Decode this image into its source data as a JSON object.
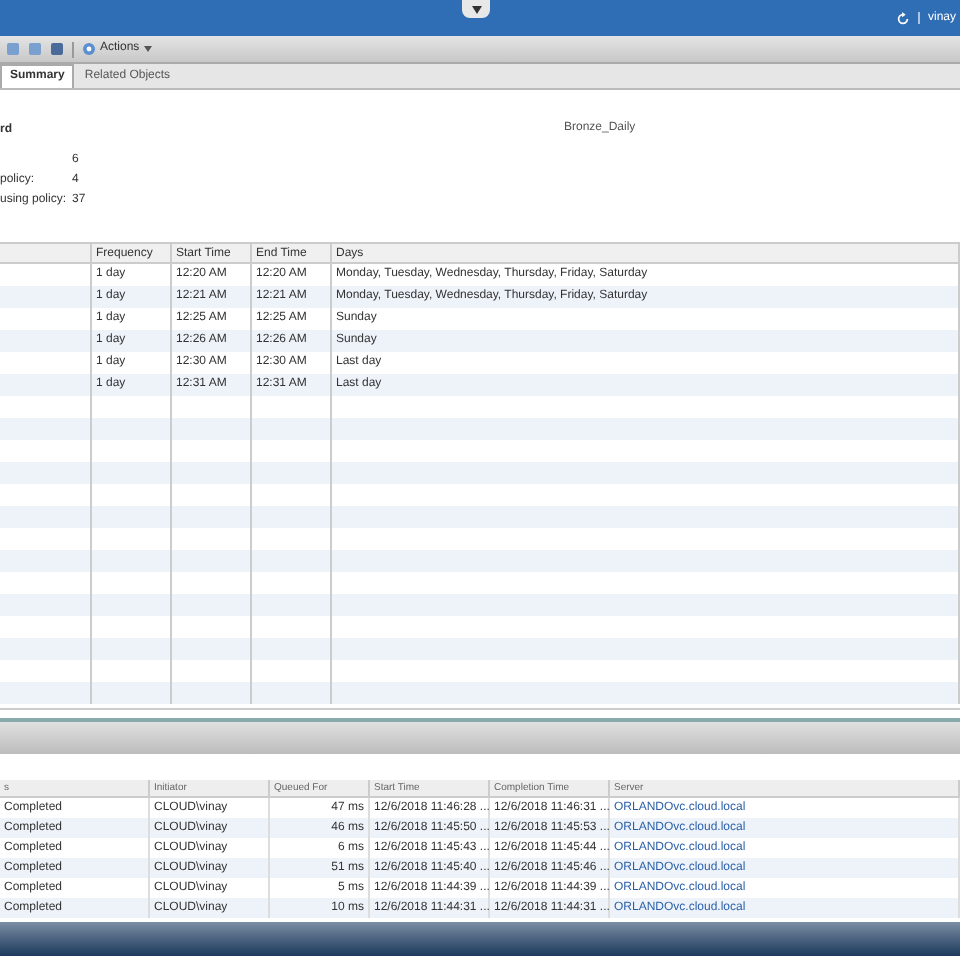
{
  "top_bar": {
    "user": "vinay"
  },
  "toolbar": {
    "actions": "Actions"
  },
  "tabs": [
    {
      "label": "Summary",
      "selected": true
    },
    {
      "label": "Related Objects",
      "selected": false
    }
  ],
  "summary": {
    "heading": "rd",
    "name": "Bronze_Daily",
    "stats": [
      {
        "value": "6"
      },
      {
        "label": "policy:",
        "value": "4"
      },
      {
        "label": "using policy:",
        "value": "37"
      }
    ]
  },
  "schedule_table": {
    "columns": [
      "Frequency",
      "Start Time",
      "End Time",
      "Days"
    ],
    "rows": [
      [
        "1 day",
        "12:20 AM",
        "12:20 AM",
        "Monday, Tuesday, Wednesday, Thursday, Friday, Saturday"
      ],
      [
        "1 day",
        "12:21 AM",
        "12:21 AM",
        "Monday, Tuesday, Wednesday, Thursday, Friday, Saturday"
      ],
      [
        "1 day",
        "12:25 AM",
        "12:25 AM",
        "Sunday"
      ],
      [
        "1 day",
        "12:26 AM",
        "12:26 AM",
        "Sunday"
      ],
      [
        "1 day",
        "12:30 AM",
        "12:30 AM",
        "Last day"
      ],
      [
        "1 day",
        "12:31 AM",
        "12:31 AM",
        "Last day"
      ]
    ]
  },
  "tasks_table": {
    "columns": [
      "s",
      "Initiator",
      "Queued For",
      "Start Time",
      "Completion Time",
      "Server"
    ],
    "rows": [
      [
        "Completed",
        "CLOUD\\vinay",
        "47 ms",
        "12/6/2018 11:46:28 ...",
        "12/6/2018 11:46:31 ...",
        "ORLANDOvc.cloud.local"
      ],
      [
        "Completed",
        "CLOUD\\vinay",
        "46 ms",
        "12/6/2018 11:45:50 ...",
        "12/6/2018 11:45:53 ...",
        "ORLANDOvc.cloud.local"
      ],
      [
        "Completed",
        "CLOUD\\vinay",
        "6 ms",
        "12/6/2018 11:45:43 ...",
        "12/6/2018 11:45:44 ...",
        "ORLANDOvc.cloud.local"
      ],
      [
        "Completed",
        "CLOUD\\vinay",
        "51 ms",
        "12/6/2018 11:45:40 ...",
        "12/6/2018 11:45:46 ...",
        "ORLANDOvc.cloud.local"
      ],
      [
        "Completed",
        "CLOUD\\vinay",
        "5 ms",
        "12/6/2018 11:44:39 ...",
        "12/6/2018 11:44:39 ...",
        "ORLANDOvc.cloud.local"
      ],
      [
        "Completed",
        "CLOUD\\vinay",
        "10 ms",
        "12/6/2018 11:44:31 ...",
        "12/6/2018 11:44:31 ...",
        "ORLANDOvc.cloud.local"
      ]
    ]
  }
}
